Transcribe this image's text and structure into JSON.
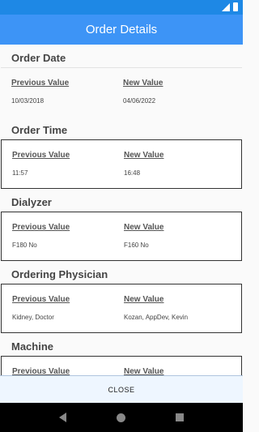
{
  "header": {
    "title": "Order Details"
  },
  "sections": [
    {
      "title": "Order Date",
      "prev_label": "Previous Value",
      "new_label": "New Value",
      "prev_value": "10/03/2018",
      "new_value": "04/06/2022"
    },
    {
      "title": "Order Time",
      "prev_label": "Previous Value",
      "new_label": "New Value",
      "prev_value": "11:57",
      "new_value": "16:48"
    },
    {
      "title": "Dialyzer",
      "prev_label": "Previous Value",
      "new_label": "New Value",
      "prev_value": "F180 No",
      "new_value": "F160 No"
    },
    {
      "title": "Ordering Physician",
      "prev_label": "Previous Value",
      "new_label": "New Value",
      "prev_value": "Kidney, Doctor",
      "new_value": "Kozan, AppDev, Kevin"
    },
    {
      "title": "Machine",
      "prev_label": "Previous Value",
      "new_label": "New Value",
      "prev_value": "",
      "new_value": ""
    }
  ],
  "footer": {
    "close_label": "CLOSE"
  },
  "colors": {
    "status_bar": "#1e88e5",
    "app_bar": "#3d94f6",
    "close_bar": "#eef6ff"
  }
}
